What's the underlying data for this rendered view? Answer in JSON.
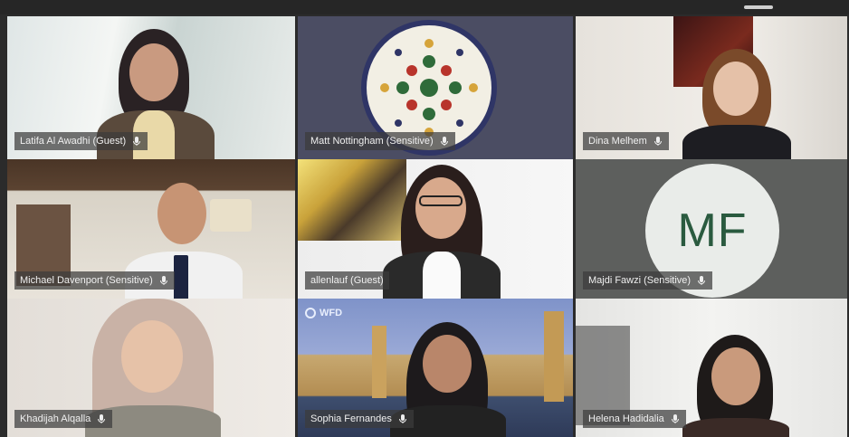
{
  "participants": [
    {
      "name": "Latifa Al Awadhi (Guest)"
    },
    {
      "name": "Matt Nottingham (Sensitive)"
    },
    {
      "name": "Dina Melhem"
    },
    {
      "name": "Michael Davenport (Sensitive)"
    },
    {
      "name": "allenlauf (Guest)"
    },
    {
      "name": "Majdi Fawzi (Sensitive)",
      "initials": "MF"
    },
    {
      "name": "Khadijah Alqalla"
    },
    {
      "name": "Sophia Fernandes",
      "background_logo": "WFD"
    },
    {
      "name": "Helena Hadidalia"
    }
  ],
  "icons": {
    "mic": "microphone-icon"
  },
  "colors": {
    "avatar_bg": "#e9ece9",
    "avatar_text": "#2a5a3f",
    "label_bg": "rgba(60,60,60,0.72)"
  }
}
